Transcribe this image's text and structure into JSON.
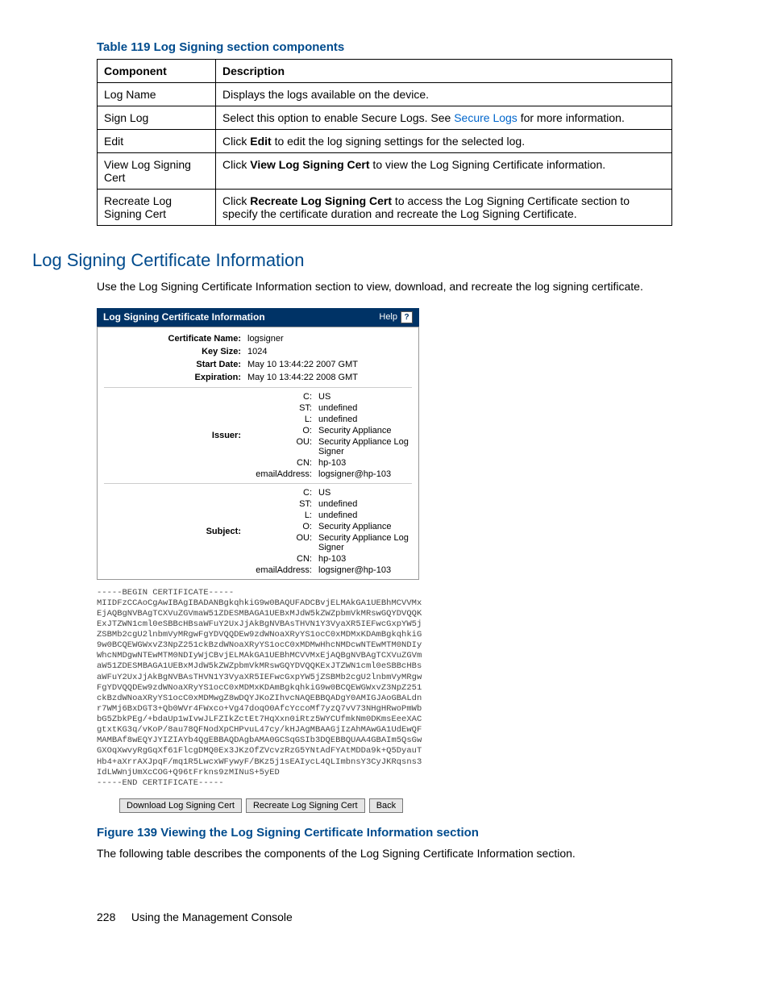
{
  "table119": {
    "title": "Table 119 Log Signing section components",
    "head": {
      "c1": "Component",
      "c2": "Description"
    },
    "rows": [
      {
        "c1": "Log Name",
        "c2": "Displays the logs available on the device."
      },
      {
        "c1": "Sign Log",
        "c2_pre": "Select this option to enable Secure Logs. See ",
        "c2_link": "Secure Logs",
        "c2_post": " for more information."
      },
      {
        "c1": "Edit",
        "c2_pre": "Click ",
        "c2_bold": "Edit",
        "c2_post": " to edit the log signing settings for the selected log."
      },
      {
        "c1": "View Log Signing Cert",
        "c2_pre": "Click ",
        "c2_bold": "View Log Signing Cert",
        "c2_post": " to view the Log Signing Certificate information."
      },
      {
        "c1": "Recreate Log Signing Cert",
        "c2_pre": "Click ",
        "c2_bold": "Recreate Log Signing Cert",
        "c2_post": " to access the Log Signing Certificate section to specify the certificate duration and recreate the Log Signing Certificate."
      }
    ]
  },
  "section_heading": "Log Signing Certificate Information",
  "section_para": "Use the Log Signing Certificate Information section to view, download, and recreate the log signing certificate.",
  "shot": {
    "header_title": "Log Signing Certificate Information",
    "help_label": "Help",
    "help_icon": "?",
    "cert_name_label": "Certificate Name:",
    "cert_name_value": "logsigner",
    "key_size_label": "Key Size:",
    "key_size_value": "1024",
    "start_date_label": "Start Date:",
    "start_date_value": "May 10 13:44:22 2007 GMT",
    "expiration_label": "Expiration:",
    "expiration_value": "May 10 13:44:22 2008 GMT",
    "issuer_label": "Issuer:",
    "subject_label": "Subject:",
    "dn": {
      "C_k": "C:",
      "C_v": "US",
      "ST_k": "ST:",
      "ST_v": "undefined",
      "L_k": "L:",
      "L_v": "undefined",
      "O_k": "O:",
      "O_v": "Security Appliance",
      "OU_k": "OU:",
      "OU_v": "Security Appliance Log Signer",
      "CN_k": "CN:",
      "CN_v": "hp-103",
      "email_k": "emailAddress:",
      "email_v": "logsigner@hp-103"
    }
  },
  "chart_data": {
    "type": "table",
    "title": "Log Signing Certificate Information",
    "fields": {
      "Certificate Name": "logsigner",
      "Key Size": "1024",
      "Start Date": "May 10 13:44:22 2007 GMT",
      "Expiration": "May 10 13:44:22 2008 GMT",
      "Issuer": {
        "C": "US",
        "ST": "undefined",
        "L": "undefined",
        "O": "Security Appliance",
        "OU": "Security Appliance Log Signer",
        "CN": "hp-103",
        "emailAddress": "logsigner@hp-103"
      },
      "Subject": {
        "C": "US",
        "ST": "undefined",
        "L": "undefined",
        "O": "Security Appliance",
        "OU": "Security Appliance Log Signer",
        "CN": "hp-103",
        "emailAddress": "logsigner@hp-103"
      }
    }
  },
  "cert_pem": "-----BEGIN CERTIFICATE-----\nMIIDFzCCAoCgAwIBAgIBADANBgkqhkiG9w0BAQUFADCBvjELMAkGA1UEBhMCVVMx\nEjAQBgNVBAgTCXVuZGVmaW51ZDESMBAGA1UEBxMJdW5kZWZpbmVkMRswGQYDVQQK\nExJTZWN1cml0eSBBcHBsaWFuY2UxJjAkBgNVBAsTHVN1Y3VyaXR5IEFwcGxpYW5j\nZSBMb2cgU2lnbmVyMRgwFgYDVQQDEw9zdWNoaXRyYS1ocC0xMDMxKDAmBgkqhkiG\n9w0BCQEWGWxvZ3NpZ251ckBzdWNoaXRyYS1ocC0xMDMwHhcNMDcwNTEwMTM0NDIy\nWhcNMDgwNTEwMTM0NDIyWjCBvjELMAkGA1UEBhMCVVMxEjAQBgNVBAgTCXVuZGVm\naW51ZDESMBAGA1UEBxMJdW5kZWZpbmVkMRswGQYDVQQKExJTZWN1cml0eSBBcHBs\naWFuY2UxJjAkBgNVBAsTHVN1Y3VyaXR5IEFwcGxpYW5jZSBMb2cgU2lnbmVyMRgw\nFgYDVQQDEw9zdWNoaXRyYS1ocC0xMDMxKDAmBgkqhkiG9w0BCQEWGWxvZ3NpZ251\nckBzdWNoaXRyYS1ocC0xMDMwgZ8wDQYJKoZIhvcNAQEBBQADgY0AMIGJAoGBALdn\nr7WMj6BxDGT3+Qb0WVr4FWxco+Vg47doqO0AfcYccoMf7yzQ7vV73NHgHRwoPmWb\nbG5ZbkPEg/+bdaUp1wIvwJLFZIkZctEt7HqXxn0iRtz5WYCUfmkNm0DKmsEeeXAC\ngtxtKG3q/vKoP/8au78QFNodXpCHPvuL47cy/kHJAgMBAAGjIzAhMAwGA1UdEwQF\nMAMBAf8wEQYJYIZIAYb4QgEBBAQDAgbAMA0GCSqGSIb3DQEBBQUAA4GBAIm5QsGw\nGXOqXwvyRgGqXf61FlcgDMQ0Ex3JKzOfZVcvzRzG5YNtAdFYAtMDDa9k+Q5DyauT\nHb4+aXrrAXJpqF/mq1R5LwcxWFywyF/BKz5j1sEAIycL4QLImbnsY3CyJKRqsns3\nIdLWWnjUmXcCOG+Q96tFrkns9zMINuS+5yED\n-----END CERTIFICATE-----",
  "buttons": {
    "download": "Download Log Signing Cert",
    "recreate": "Recreate Log Signing Cert",
    "back": "Back"
  },
  "figure_title": "Figure 139 Viewing the Log Signing Certificate Information section",
  "after_figure_para": "The following table describes the components of the Log Signing Certificate Information section.",
  "footer_page": "228",
  "footer_text": "Using the Management Console"
}
